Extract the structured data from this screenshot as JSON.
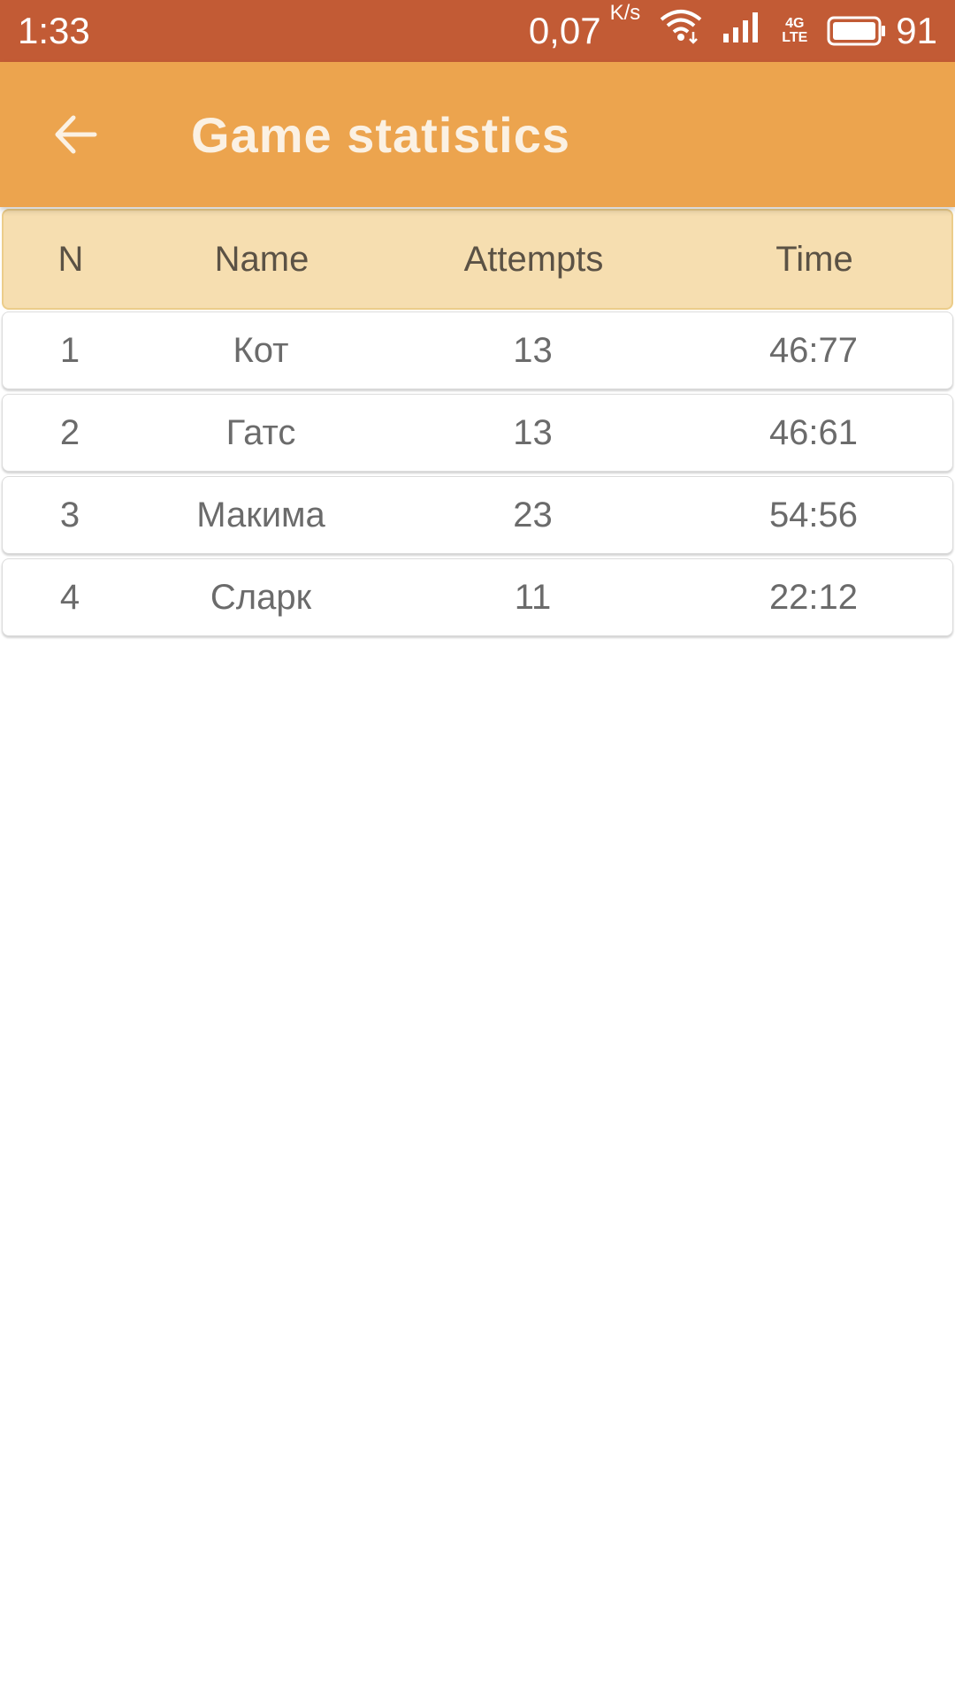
{
  "status_bar": {
    "time": "1:33",
    "net_speed_value": "0,07",
    "net_speed_unit": "K/s",
    "network_type_top": "4G",
    "network_type_bottom": "LTE",
    "battery_level": "91",
    "icons": [
      "wifi-icon",
      "signal-icon",
      "battery-icon"
    ]
  },
  "app_bar": {
    "back_icon": "arrow-left-icon",
    "title": "Game statistics",
    "color": "#eca44e"
  },
  "table": {
    "columns": [
      "N",
      "Name",
      "Attempts",
      "Time"
    ],
    "rows": [
      {
        "n": "1",
        "name": "Кот",
        "attempts": "13",
        "time": "46:77"
      },
      {
        "n": "2",
        "name": "Гатс",
        "attempts": "13",
        "time": "46:61"
      },
      {
        "n": "3",
        "name": "Макима",
        "attempts": "23",
        "time": "54:56"
      },
      {
        "n": "4",
        "name": "Сларк",
        "attempts": "11",
        "time": "22:12"
      }
    ]
  },
  "colors": {
    "status_bar": "#c25b35",
    "app_bar": "#eca44e",
    "header_row": "#f6deb0"
  }
}
